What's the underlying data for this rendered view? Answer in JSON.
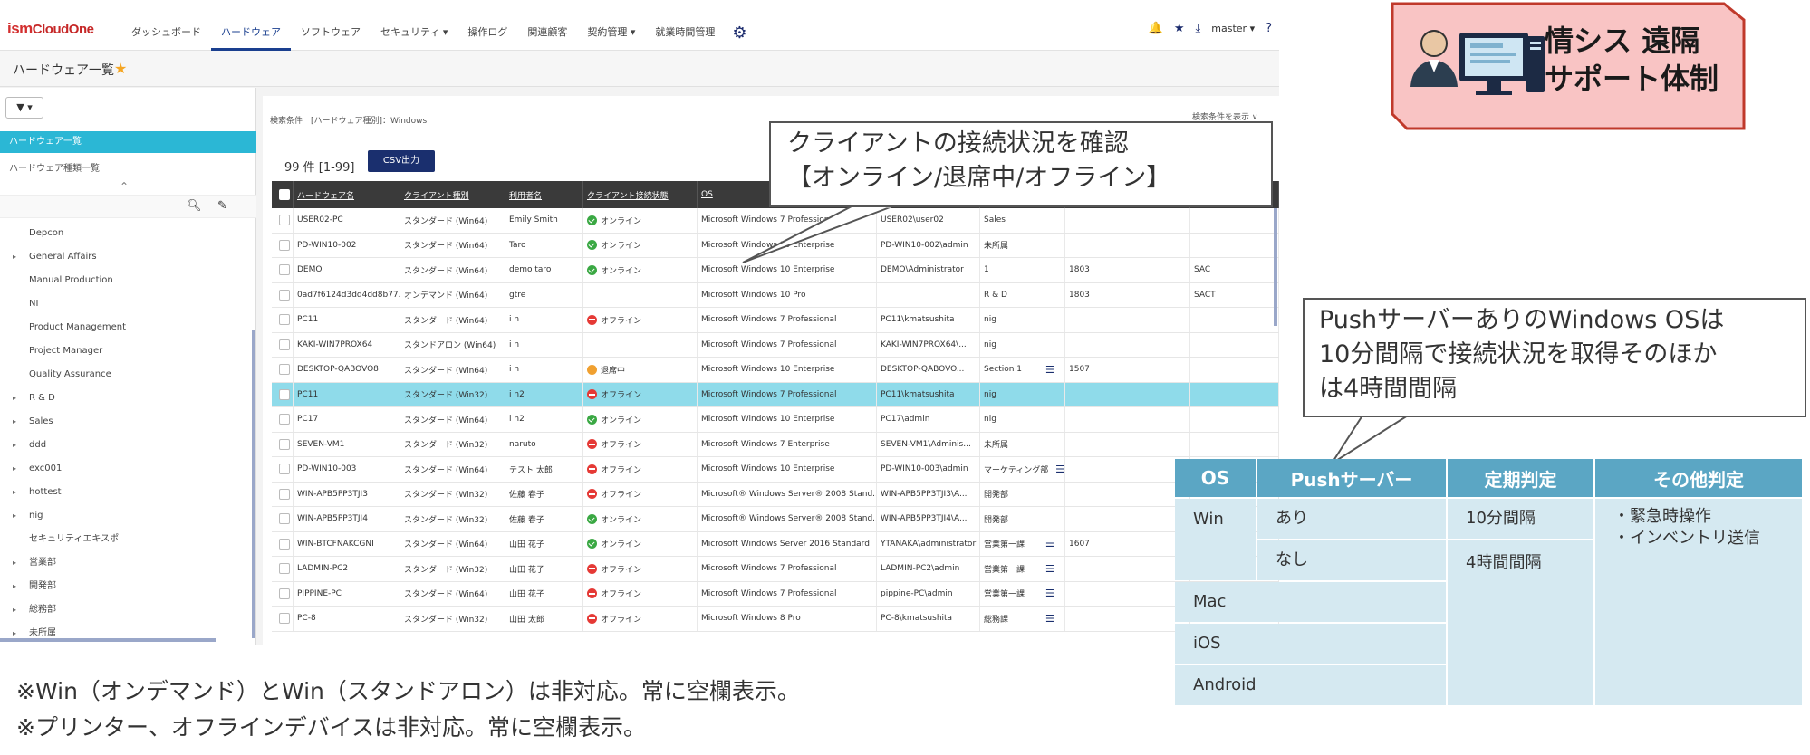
{
  "app": {
    "logo_ism": "ism",
    "logo_cloud": "CloudOne",
    "nav": [
      "ダッシュボード",
      "ハードウェア",
      "ソフトウェア",
      "セキュリティ ▾",
      "操作ログ",
      "関連顧客",
      "契約管理 ▾",
      "就業時間管理"
    ],
    "active_nav_index": 1,
    "user": "master ▾",
    "page_title": "ハードウェア一覧"
  },
  "sidebar": {
    "filter_label": "▼ ▾",
    "active_item": "ハードウェア一覧",
    "item2": "ハードウェア種類一覧",
    "tree": [
      {
        "label": "Depcon",
        "arrow": false
      },
      {
        "label": "General Affairs",
        "arrow": true
      },
      {
        "label": "Manual Production",
        "arrow": false
      },
      {
        "label": "NI",
        "arrow": false
      },
      {
        "label": "Product Management",
        "arrow": false
      },
      {
        "label": "Project Manager",
        "arrow": false
      },
      {
        "label": "Quality Assurance",
        "arrow": false
      },
      {
        "label": "R & D",
        "arrow": true
      },
      {
        "label": "Sales",
        "arrow": true
      },
      {
        "label": "ddd",
        "arrow": true
      },
      {
        "label": "exc001",
        "arrow": true
      },
      {
        "label": "hottest",
        "arrow": true
      },
      {
        "label": "nig",
        "arrow": true
      },
      {
        "label": "セキュリティエキスポ",
        "arrow": false
      },
      {
        "label": "営業部",
        "arrow": true
      },
      {
        "label": "開発部",
        "arrow": true
      },
      {
        "label": "総務部",
        "arrow": true
      },
      {
        "label": "未所属",
        "arrow": true
      }
    ]
  },
  "main": {
    "condition": "検索条件　[ハードウェア種別]：Windows",
    "condition_link": "検索条件を表示 ∨",
    "count": "99 件 [1-99]",
    "csv_button": "CSV出力",
    "headers": [
      "ハードウェア名",
      "クライアント種別",
      "利用者名",
      "クライアント接続状態",
      "OS",
      "",
      "",
      "",
      ""
    ],
    "rows": [
      {
        "name": "USER02-PC",
        "type": "スタンダード (Win64)",
        "user": "Emily Smith",
        "status": "green",
        "status_text": "オンライン",
        "os": "Microsoft Windows 7 Professional",
        "login": "USER02\\user02",
        "dept": "Sales",
        "menu": false,
        "c1": "",
        "c2": ""
      },
      {
        "name": "PD-WIN10-002",
        "type": "スタンダード (Win64)",
        "user": "Taro",
        "status": "green",
        "status_text": "オンライン",
        "os": "Microsoft Windows 10 Enterprise",
        "login": "PD-WIN10-002\\admin",
        "dept": "未所属",
        "menu": false,
        "c1": "",
        "c2": ""
      },
      {
        "name": "DEMO",
        "type": "スタンダード (Win64)",
        "user": "demo taro",
        "status": "green",
        "status_text": "オンライン",
        "os": "Microsoft Windows 10 Enterprise",
        "login": "DEMO\\Administrator",
        "dept": "1",
        "menu": false,
        "c1": "1803",
        "c2": "SAC"
      },
      {
        "name": "0ad7f6124d3dd4dd8b77...",
        "type": "オンデマンド (Win64)",
        "user": "gtre",
        "status": "",
        "status_text": "",
        "os": "Microsoft Windows 10 Pro",
        "login": "",
        "dept": "R & D",
        "menu": false,
        "c1": "1803",
        "c2": "SACT"
      },
      {
        "name": "PC11",
        "type": "スタンダード (Win64)",
        "user": "i n",
        "status": "red",
        "status_text": "オフライン",
        "os": "Microsoft Windows 7 Professional",
        "login": "PC11\\kmatsushita",
        "dept": "nig",
        "menu": false,
        "c1": "",
        "c2": ""
      },
      {
        "name": "KAKI-WIN7PROX64",
        "type": "スタンドアロン (Win64)",
        "user": "i n",
        "status": "",
        "status_text": "",
        "os": "Microsoft Windows 7 Professional",
        "login": "KAKI-WIN7PROX64\\...",
        "dept": "nig",
        "menu": false,
        "c1": "",
        "c2": ""
      },
      {
        "name": "DESKTOP-QABOVO8",
        "type": "スタンダード (Win64)",
        "user": "i n",
        "status": "orange",
        "status_text": "退席中",
        "os": "Microsoft Windows 10 Enterprise",
        "login": "DESKTOP-QABOVO...",
        "dept": "Section 1",
        "menu": true,
        "c1": "1507",
        "c2": ""
      },
      {
        "name": "PC11",
        "type": "スタンダード (Win32)",
        "user": "i n2",
        "status": "red",
        "status_text": "オフライン",
        "os": "Microsoft Windows 7 Professional",
        "login": "PC11\\kmatsushita",
        "dept": "nig",
        "menu": false,
        "c1": "",
        "c2": "",
        "selected": true
      },
      {
        "name": "PC17",
        "type": "スタンダード (Win64)",
        "user": "i n2",
        "status": "green",
        "status_text": "オンライン",
        "os": "Microsoft Windows 10 Enterprise",
        "login": "PC17\\admin",
        "dept": "nig",
        "menu": false,
        "c1": "",
        "c2": ""
      },
      {
        "name": "SEVEN-VM1",
        "type": "スタンダード (Win32)",
        "user": "naruto",
        "status": "red",
        "status_text": "オフライン",
        "os": "Microsoft Windows 7 Enterprise",
        "login": "SEVEN-VM1\\Adminis...",
        "dept": "未所属",
        "menu": false,
        "c1": "",
        "c2": ""
      },
      {
        "name": "PD-WIN10-003",
        "type": "スタンダード (Win64)",
        "user": "テスト 太郎",
        "status": "red",
        "status_text": "オフライン",
        "os": "Microsoft Windows 10 Enterprise",
        "login": "PD-WIN10-003\\admin",
        "dept": "マーケティング部",
        "menu": true,
        "c1": "",
        "c2": ""
      },
      {
        "name": "WIN-APB5PP3TJI3",
        "type": "スタンダード (Win32)",
        "user": "佐藤 春子",
        "status": "red",
        "status_text": "オフライン",
        "os": "Microsoft® Windows Server® 2008 Stand...",
        "login": "WIN-APB5PP3TJI3\\A...",
        "dept": "開発部",
        "menu": false,
        "c1": "",
        "c2": ""
      },
      {
        "name": "WIN-APB5PP3TJI4",
        "type": "スタンダード (Win32)",
        "user": "佐藤 春子",
        "status": "green",
        "status_text": "オンライン",
        "os": "Microsoft® Windows Server® 2008 Stand...",
        "login": "WIN-APB5PP3TJI4\\A...",
        "dept": "開発部",
        "menu": false,
        "c1": "",
        "c2": ""
      },
      {
        "name": "WIN-BTCFNAKCGNI",
        "type": "スタンダード (Win64)",
        "user": "山田 花子",
        "status": "green",
        "status_text": "オンライン",
        "os": "Microsoft Windows Server 2016 Standard",
        "login": "YTANAKA\\administrator",
        "dept": "営業第一課",
        "menu": true,
        "c1": "1607",
        "c2": ""
      },
      {
        "name": "LADMIN-PC2",
        "type": "スタンダード (Win32)",
        "user": "山田 花子",
        "status": "red",
        "status_text": "オフライン",
        "os": "Microsoft Windows 7 Professional",
        "login": "LADMIN-PC2\\admin",
        "dept": "営業第一課",
        "menu": true,
        "c1": "",
        "c2": ""
      },
      {
        "name": "PIPPINE-PC",
        "type": "スタンダード (Win64)",
        "user": "山田 花子",
        "status": "red",
        "status_text": "オフライン",
        "os": "Microsoft Windows 7 Professional",
        "login": "pippine-PC\\admin",
        "dept": "営業第一課",
        "menu": true,
        "c1": "",
        "c2": ""
      },
      {
        "name": "PC-8",
        "type": "スタンダード (Win32)",
        "user": "山田 太郎",
        "status": "red",
        "status_text": "オフライン",
        "os": "Microsoft Windows 8 Pro",
        "login": "PC-8\\kmatsushita",
        "dept": "総務課",
        "menu": true,
        "c1": "",
        "c2": ""
      }
    ]
  },
  "callout1": {
    "line1": "クライアントの接続状況を確認",
    "line2": "【オンライン/退席中/オフライン】"
  },
  "callout2": {
    "line1": "PushサーバーありのWindows OSは",
    "line2": "10分間隔で接続状況を取得そのほか",
    "line3": "は4時間間隔"
  },
  "badge": {
    "line1": "情シス 遠隔",
    "line2": "サポート体制",
    "border_color": "#c0392b",
    "fill_color": "#f9c4c4"
  },
  "table": {
    "headers": [
      "OS",
      "Pushサーバー",
      "定期判定",
      "その他判定"
    ],
    "win": "Win",
    "push_yes": "あり",
    "push_no": "なし",
    "mac": "Mac",
    "ios": "iOS",
    "android": "Android",
    "interval_10": "10分間隔",
    "interval_4h": "4時間間隔",
    "other1": "・緊急時操作",
    "other2": "・インベントリ送信",
    "header_color": "#5ba6c4",
    "body_color": "#d5e9f1"
  },
  "notes": {
    "line1": "※Win（オンデマンド）とWin（スタンドアロン）は非対応。常に空欄表示。",
    "line2": "※プリンター、オフラインデバイスは非対応。常に空欄表示。"
  }
}
